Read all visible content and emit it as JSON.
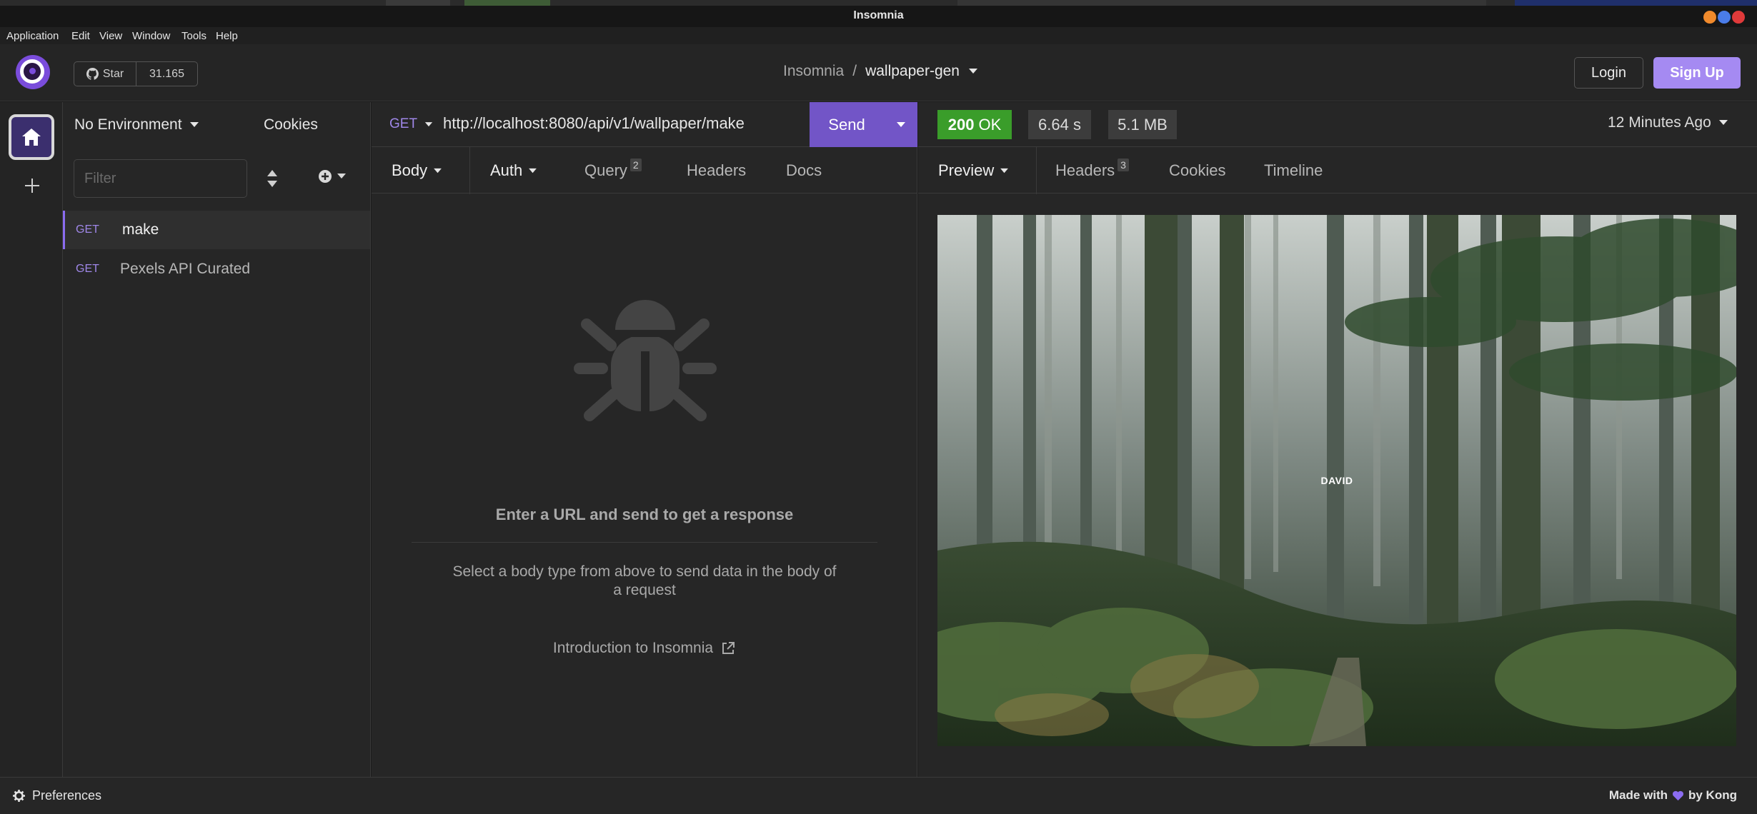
{
  "window": {
    "title": "Insomnia"
  },
  "menu": [
    "Application",
    "Edit",
    "View",
    "Window",
    "Tools",
    "Help"
  ],
  "header": {
    "github_star_label": "Star",
    "github_star_count": "31.165",
    "breadcrumb_root": "Insomnia",
    "breadcrumb_separator": "/",
    "project_name": "wallpaper-gen",
    "login_label": "Login",
    "signup_label": "Sign Up"
  },
  "sidebar": {
    "environment": "No Environment",
    "cookies_label": "Cookies",
    "filter_placeholder": "Filter",
    "requests": [
      {
        "method": "GET",
        "name": "make",
        "active": true
      },
      {
        "method": "GET",
        "name": "Pexels API Curated",
        "active": false
      }
    ]
  },
  "request": {
    "method": "GET",
    "url": "http://localhost:8080/api/v1/wallpaper/make",
    "send_label": "Send",
    "tabs": [
      {
        "label": "Body",
        "badge": ""
      },
      {
        "label": "Auth",
        "badge": ""
      },
      {
        "label": "Query",
        "badge": "2"
      },
      {
        "label": "Headers",
        "badge": ""
      },
      {
        "label": "Docs",
        "badge": ""
      }
    ],
    "empty_title": "Enter a URL and send to get a response",
    "empty_description": "Select a body type from above to send data in the body of a request",
    "intro_link": "Introduction to Insomnia"
  },
  "response": {
    "status_code": "200",
    "status_text": "OK",
    "time": "6.64 s",
    "size": "5.1 MB",
    "time_ago": "12 Minutes Ago",
    "tabs": [
      {
        "label": "Preview",
        "badge": ""
      },
      {
        "label": "Headers",
        "badge": "3"
      },
      {
        "label": "Cookies",
        "badge": ""
      },
      {
        "label": "Timeline",
        "badge": ""
      }
    ],
    "preview_overlay_text": "DAVID"
  },
  "footer": {
    "preferences_label": "Preferences",
    "made_with_prefix": "Made with",
    "made_with_suffix": "by Kong"
  },
  "colors": {
    "accent": "#7255c7",
    "method": "#9f87e8",
    "status_ok": "#3a9d2a",
    "signup": "#a58af2"
  }
}
